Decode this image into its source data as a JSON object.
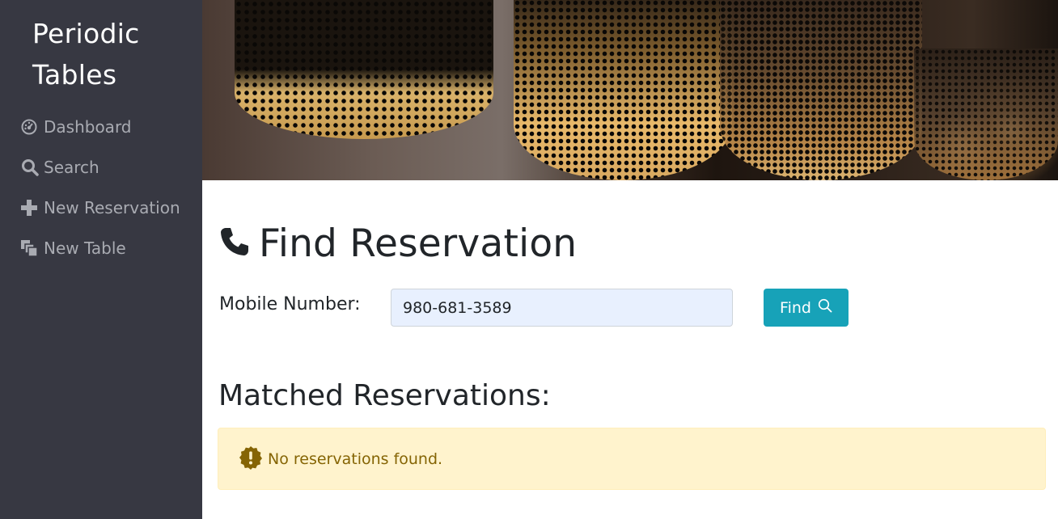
{
  "sidebar": {
    "brand_line1": "Periodic",
    "brand_line2": "Tables",
    "items": [
      {
        "label": "Dashboard",
        "icon": "dashboard-icon"
      },
      {
        "label": "Search",
        "icon": "search-icon"
      },
      {
        "label": "New Reservation",
        "icon": "plus-icon"
      },
      {
        "label": "New Table",
        "icon": "layers-icon"
      }
    ]
  },
  "main": {
    "title": "Find Reservation",
    "title_icon": "phone-icon",
    "form": {
      "label": "Mobile Number:",
      "mobile_value": "980-681-3589",
      "find_label": "Find",
      "find_icon": "search-icon"
    },
    "results_title": "Matched Reservations:",
    "alert": {
      "icon": "exclamation-icon",
      "text": "No reservations found."
    }
  },
  "colors": {
    "sidebar_bg": "#373842",
    "sidebar_text": "#a9abb2",
    "button_bg": "#17a2b8",
    "input_bg": "#e8f0fe",
    "alert_bg": "#fff3cd",
    "alert_text": "#856404"
  }
}
